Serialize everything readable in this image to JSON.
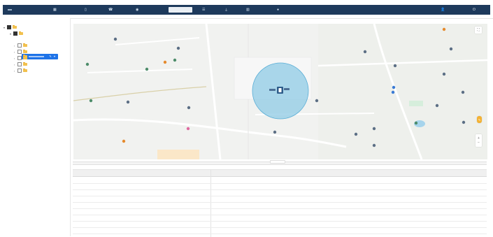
{
  "nav": {
    "items": [
      {
        "icon": "dashboard-icon",
        "glyph": "▦"
      },
      {
        "icon": "device-icon",
        "glyph": "▯"
      },
      {
        "icon": "contact-icon",
        "glyph": "☎"
      },
      {
        "icon": "monitor-icon",
        "glyph": "◉"
      },
      {
        "icon": "todo-icon",
        "glyph": "☰"
      },
      {
        "icon": "filter-icon",
        "glyph": "⏚"
      },
      {
        "icon": "overview-icon",
        "glyph": "▥"
      },
      {
        "icon": "help-icon",
        "glyph": "●"
      }
    ],
    "user_icon_glyph": "👤",
    "logout_icon_glyph": "⏻"
  },
  "map_panel": {
    "fab_glyph": "✎",
    "zoom_in": "+",
    "zoom_out": "−"
  },
  "details": {
    "rows": [
      {
        "key": "",
        "value": ""
      },
      {
        "key": "",
        "value": ""
      },
      {
        "key": "",
        "value": ""
      },
      {
        "key": "",
        "value": ""
      },
      {
        "key": "",
        "value": ""
      },
      {
        "key": "",
        "value": ""
      },
      {
        "key": "",
        "value": ""
      },
      {
        "key": "",
        "value": ""
      },
      {
        "key": "",
        "value": ""
      }
    ]
  },
  "colors": {
    "navbar": "#1e3a5c",
    "selected": "#1e73e8",
    "geofence": "#8fcbe6",
    "geofence_stroke": "#5aaed6",
    "link": "#4d81be"
  }
}
